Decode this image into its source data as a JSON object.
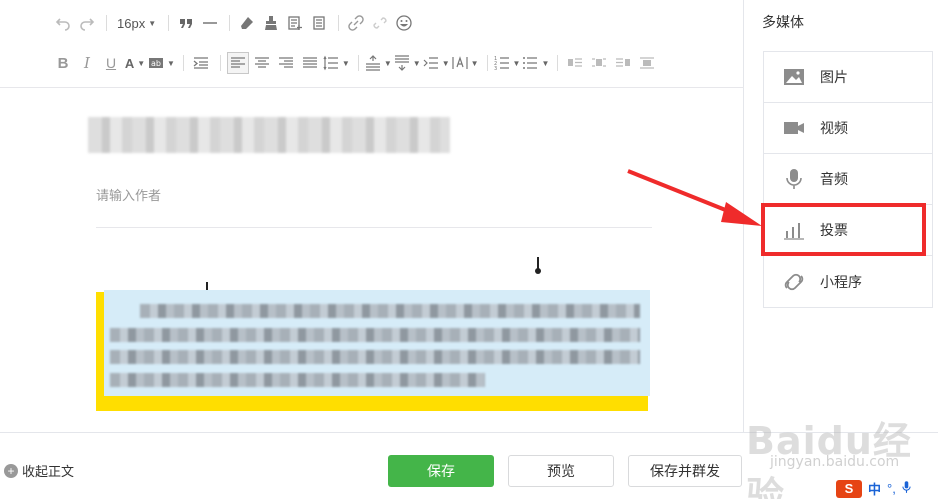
{
  "toolbar": {
    "font_size": "16px",
    "row1": [
      "undo-icon",
      "redo-icon",
      "font-size",
      "quote-icon",
      "hr-icon",
      "eraser-icon",
      "format-brush-icon",
      "insert-template-icon",
      "paste-icon",
      "link-icon",
      "unlink-icon",
      "emoji-icon"
    ],
    "row2": [
      "bold-icon",
      "italic-icon",
      "underline-icon",
      "font-color-icon",
      "background-color-icon",
      "indent-icon",
      "align-left-icon",
      "align-center-icon",
      "align-right-icon",
      "align-justify-icon",
      "line-spacing-icon",
      "spacing-before-icon",
      "spacing-after-icon",
      "letter-spacing-icon",
      "ordered-list-icon",
      "unordered-list-icon",
      "table-icon-1",
      "table-icon-2",
      "table-icon-3",
      "table-icon-4"
    ]
  },
  "editor": {
    "author_placeholder": "请输入作者"
  },
  "panel": {
    "title": "多媒体",
    "items": [
      {
        "label": "图片",
        "icon": "image-icon"
      },
      {
        "label": "视频",
        "icon": "video-icon"
      },
      {
        "label": "音频",
        "icon": "microphone-icon"
      },
      {
        "label": "投票",
        "icon": "vote-chart-icon"
      },
      {
        "label": "小程序",
        "icon": "mini-program-icon"
      }
    ],
    "highlighted_item": "投票"
  },
  "bottom": {
    "collapse_label": "收起正文",
    "save_label": "保存",
    "preview_label": "预览",
    "publish_label": "保存并群发"
  },
  "watermark": {
    "brand": "Baidu经验",
    "url": "jingyan.baidu.com"
  },
  "ime": {
    "logo": "S",
    "lang": "中",
    "punct": "°,"
  },
  "colors": {
    "accent_green": "#44b549",
    "highlight_red": "#ef2b2b",
    "content_yellow": "#ffde00",
    "content_blue": "#d6ecf8"
  }
}
